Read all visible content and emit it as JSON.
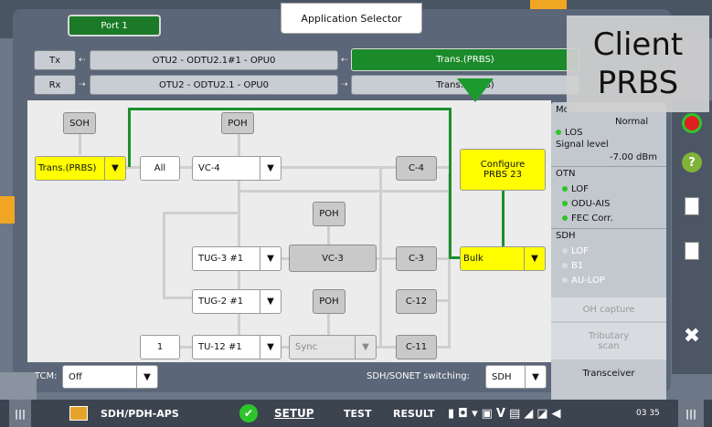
{
  "header": {
    "port_tab": "Port 1",
    "app_selector": "Application Selector"
  },
  "paths": {
    "tx_label": "Tx",
    "rx_label": "Rx",
    "tx_path": "OTU2 - ODTU2.1#1 - OPU0",
    "rx_path": "OTU2 - ODTU2.1 - OPU0",
    "tx_mode": "Trans.(PRBS)",
    "rx_mode": "Trans.(PRBS)"
  },
  "diagram": {
    "soh": "SOH",
    "poh_top": "POH",
    "poh_mid": "POH",
    "poh_low": "POH",
    "trans_select": "Trans.(PRBS)",
    "all_label": "All",
    "vc4_select": "VC-4",
    "c4": "C-4",
    "configure_prbs": "Configure PRBS 23",
    "tug3_select": "TUG-3 #1",
    "vc3": "VC-3",
    "c3": "C-3",
    "bulk_select": "Bulk",
    "tug2_select": "TUG-2 #1",
    "c12": "C-12",
    "tu12_number": "1",
    "tu12_select": "TU-12 #1",
    "sync_select": "Sync",
    "c11": "C-11",
    "tcm_label": "TCM:",
    "tcm_value": "Off",
    "switching_label": "SDH/SONET switching:",
    "switching_value": "SDH",
    "dropdown_glyph": "▼"
  },
  "status": {
    "mode_label": "Mo",
    "mode_value": "Normal",
    "los": "LOS",
    "signal_level_label": "Signal level",
    "signal_level_value": "-7.00 dBm",
    "otn_header": "OTN",
    "otn_lof": "LOF",
    "otn_oduais": "ODU-AIS",
    "otn_fec": "FEC Corr.",
    "sdh_header": "SDH",
    "sdh_lof": "LOF",
    "sdh_b1": "B1",
    "sdh_aulop": "AU-LOP",
    "oh_capture": "OH capture",
    "tributary_scan": "Tributary scan",
    "transceiver": "Transceiver",
    "colors": {
      "green": "#2ec52b",
      "gray": "#d9dde2",
      "red": "#e02020"
    }
  },
  "toolbar": {
    "help_glyph": "?",
    "close_glyph": "✖"
  },
  "bottom": {
    "menu_glyph": "|||",
    "app_name": "SDH/PDH-APS",
    "setup": "SETUP",
    "test": "TEST",
    "result": "RESULT",
    "time": "03 35",
    "right_menu_glyph": "|||"
  },
  "overlay": {
    "line1": "Client",
    "line2": "PRBS"
  }
}
